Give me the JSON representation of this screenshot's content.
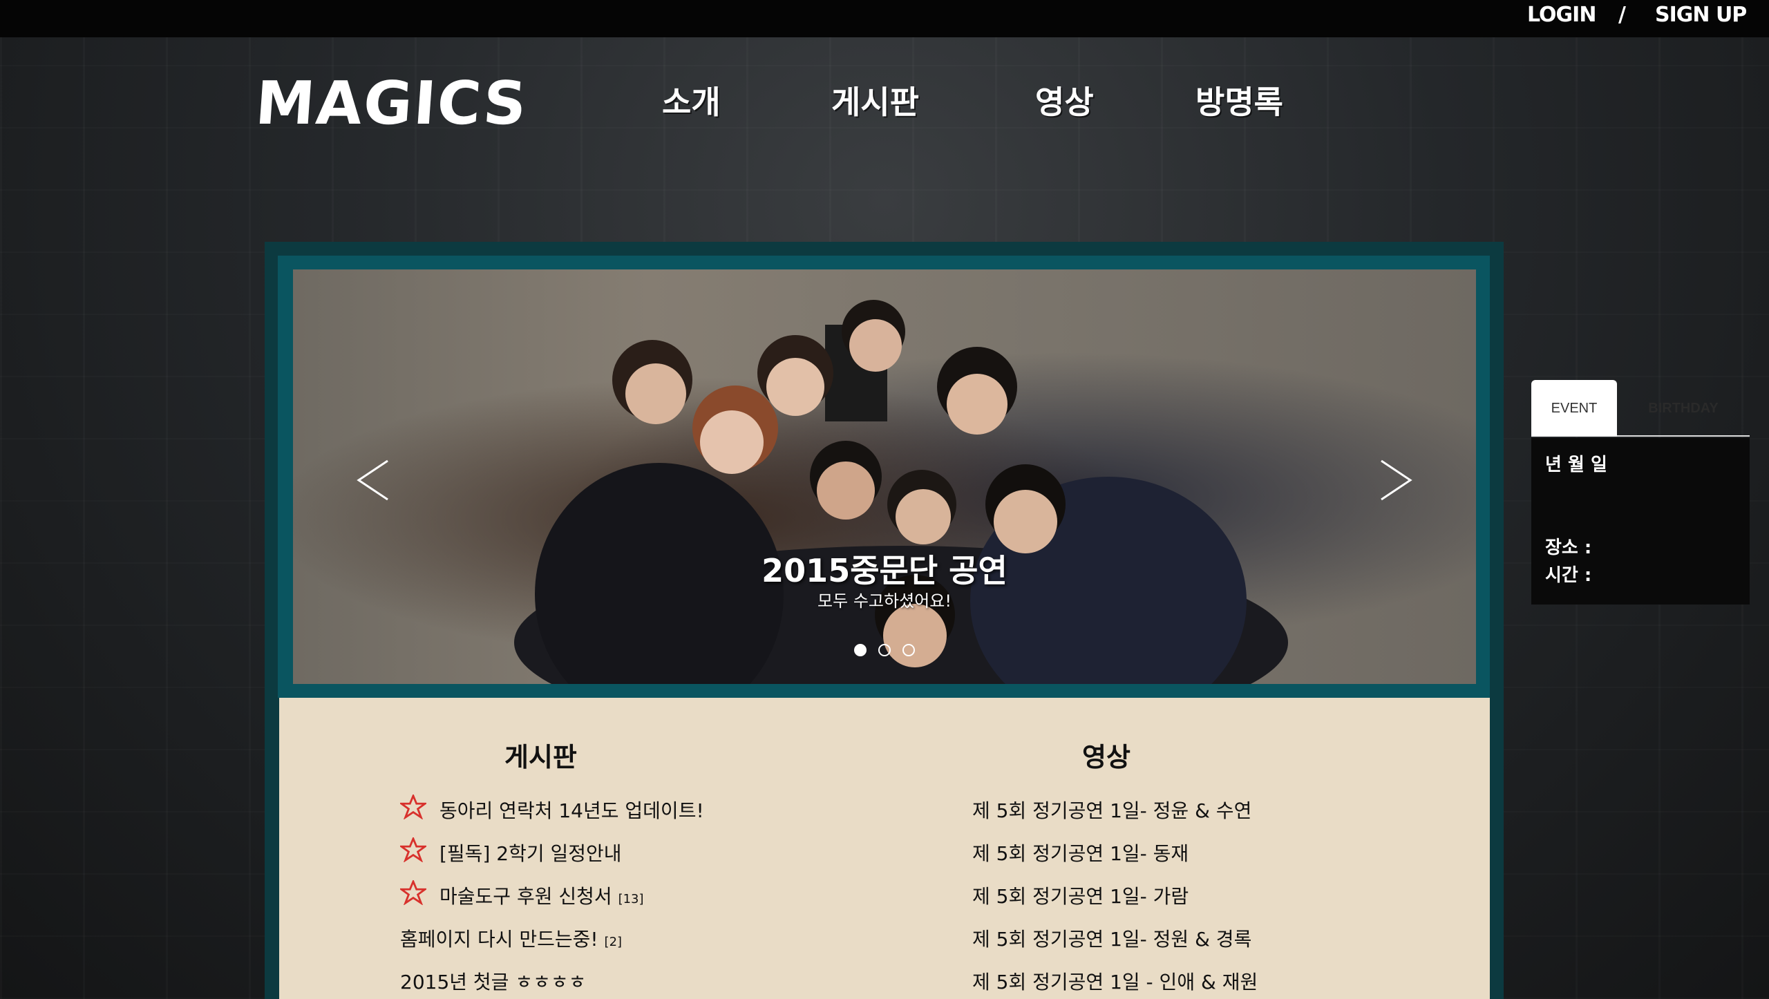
{
  "auth": {
    "login": "LOGIN",
    "separator": "/",
    "signup": "SIGN UP"
  },
  "logo": "MAGICS",
  "nav": [
    {
      "label": "소개"
    },
    {
      "label": "게시판"
    },
    {
      "label": "영상"
    },
    {
      "label": "방명록"
    }
  ],
  "slider": {
    "title": "2015중문단 공연",
    "subtitle": "모두 수고하셨어요!",
    "slide_count": 3,
    "active_slide": 1,
    "prev_icon": "chevron-left-icon",
    "next_icon": "chevron-right-icon"
  },
  "board": {
    "title": "게시판",
    "posts": [
      {
        "text": "동아리 연락처 14년도 업데이트!",
        "count": "",
        "starred": true
      },
      {
        "text": "[필독] 2학기 일정안내",
        "count": "",
        "starred": true
      },
      {
        "text": "마술도구 후원 신청서",
        "count": "[13]",
        "starred": true
      },
      {
        "text": "홈페이지 다시 만드는중!",
        "count": "[2]",
        "starred": false
      },
      {
        "text": "2015년 첫글 ㅎㅎㅎㅎ",
        "count": "",
        "starred": false
      }
    ]
  },
  "video": {
    "title": "영상",
    "items": [
      "제 5회 정기공연 1일- 정윤 & 수연",
      "제 5회 정기공연 1일- 동재",
      "제 5회 정기공연 1일- 가람",
      "제 5회 정기공연 1일- 정원 & 경록",
      "제 5회 정기공연 1일 - 인애 & 재원"
    ]
  },
  "side": {
    "tabs": {
      "event": "EVENT",
      "birthday": "BIRTHDAY"
    },
    "date": "년 월 일",
    "place_label": "장소 :",
    "time_label": "시간 :"
  },
  "colors": {
    "frame": "#0c3a40",
    "frame_inner": "#0a5560",
    "content_bg": "#e9dcc6",
    "star": "#d8312c"
  }
}
